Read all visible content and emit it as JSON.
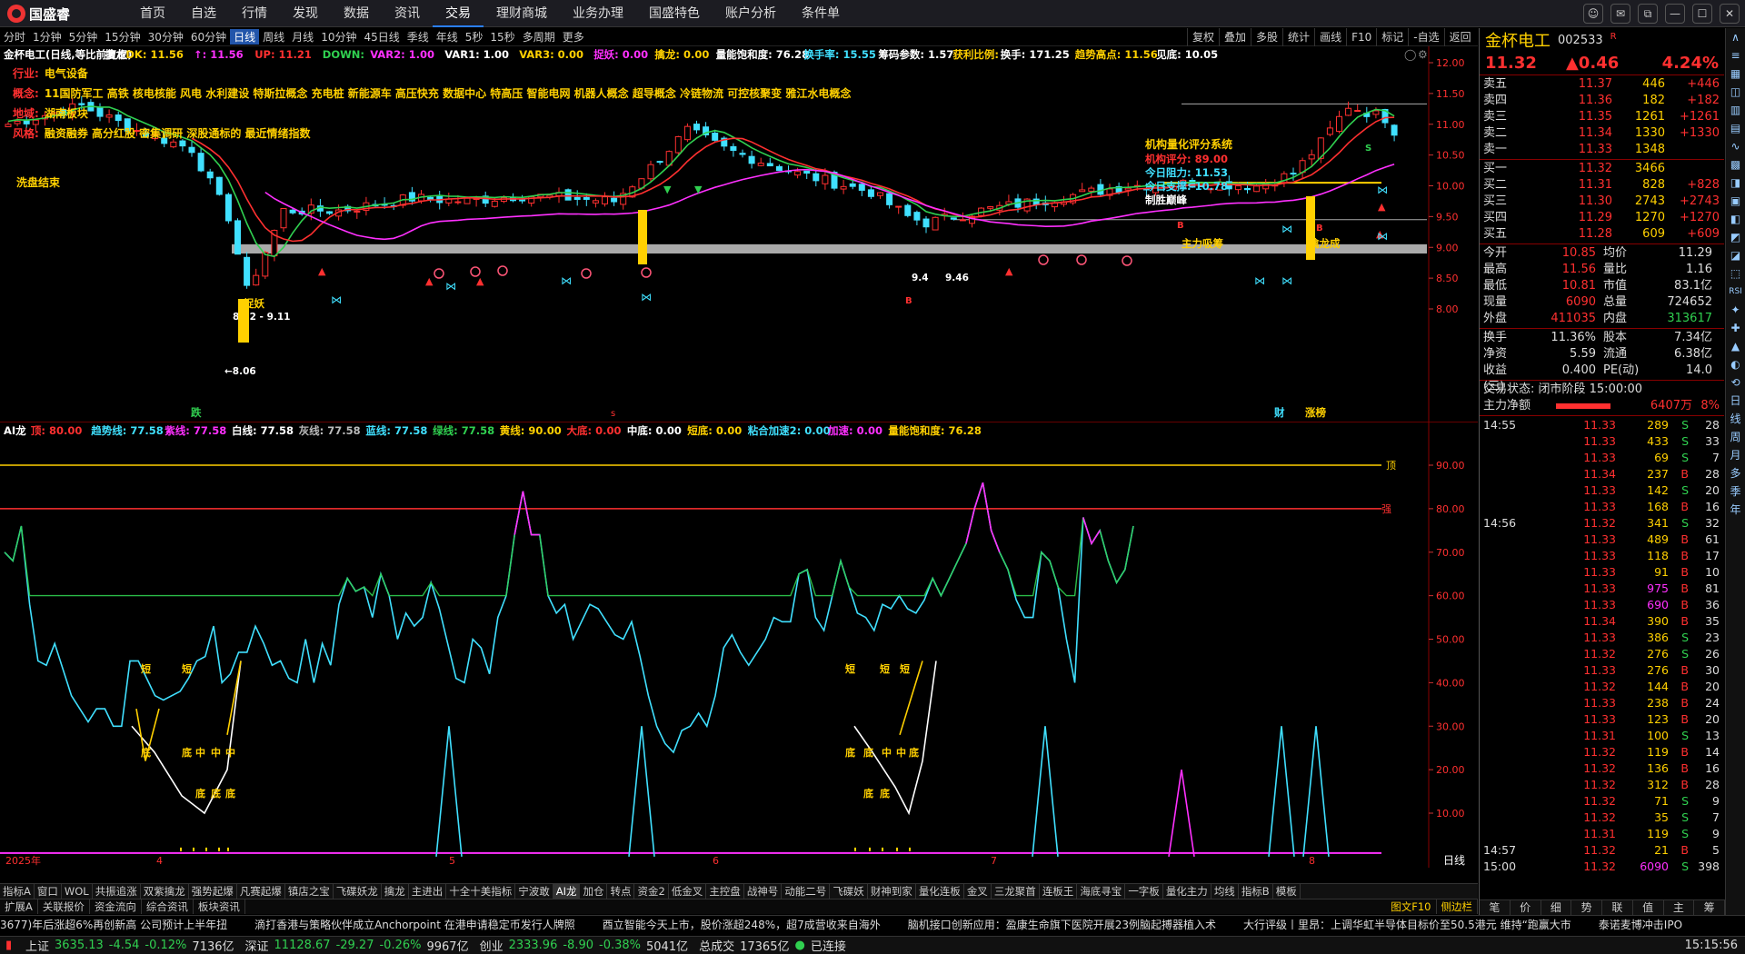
{
  "app": {
    "logo_text": "国盛睿",
    "menu": [
      {
        "label": "首页"
      },
      {
        "label": "自选"
      },
      {
        "label": "行情"
      },
      {
        "label": "发现"
      },
      {
        "label": "数据"
      },
      {
        "label": "资讯"
      },
      {
        "label": "交易",
        "active": true
      },
      {
        "label": "理财商城"
      },
      {
        "label": "业务办理"
      },
      {
        "label": "国盛特色"
      },
      {
        "label": "账户分析"
      },
      {
        "label": "条件单"
      }
    ],
    "window_buttons": [
      "☺",
      "✉",
      "⧉",
      "—",
      "☐",
      "✕"
    ]
  },
  "period_tabs": [
    {
      "label": "分时"
    },
    {
      "label": "1分钟"
    },
    {
      "label": "5分钟"
    },
    {
      "label": "15分钟"
    },
    {
      "label": "30分钟"
    },
    {
      "label": "60分钟"
    },
    {
      "label": "日线",
      "active": true
    },
    {
      "label": "周线"
    },
    {
      "label": "月线"
    },
    {
      "label": "10分钟"
    },
    {
      "label": "45日线"
    },
    {
      "label": "季线"
    },
    {
      "label": "年线"
    },
    {
      "label": "5秒"
    },
    {
      "label": "15秒"
    },
    {
      "label": "多周期"
    },
    {
      "label": "更多"
    }
  ],
  "right_tools": [
    {
      "label": "复权"
    },
    {
      "label": "叠加"
    },
    {
      "label": "多股"
    },
    {
      "label": "统计"
    },
    {
      "label": "画线"
    },
    {
      "label": "F10"
    },
    {
      "label": "标记"
    },
    {
      "label": "-自选"
    },
    {
      "label": "返回"
    }
  ],
  "main": {
    "legend": [
      {
        "t": "金杯电工(日线,等比前复权)",
        "c": "#fff"
      },
      {
        "t": "擒龙",
        "c": "#fff"
      },
      {
        "t": "DK: 11.56",
        "c": "#ffd000"
      },
      {
        "t": "↑: 11.56",
        "c": "#ff30ff"
      },
      {
        "t": "UP: 11.21",
        "c": "#ff3030"
      },
      {
        "t": "DOWN: ",
        "c": "#30d050"
      },
      {
        "t": "VAR2: 1.00",
        "c": "#ff30ff"
      },
      {
        "t": "VAR1: 1.00",
        "c": "#fff"
      },
      {
        "t": "VAR3: 0.00",
        "c": "#ffd000"
      },
      {
        "t": "捉妖: 0.00",
        "c": "#ff30ff"
      },
      {
        "t": "擒龙: 0.00",
        "c": "#ffd000"
      },
      {
        "t": "量能饱和度: 76.28",
        "c": "#fff"
      },
      {
        "t": "换手率: 15.55",
        "c": "#40e0ff"
      },
      {
        "t": "筹码参数: 1.57",
        "c": "#fff"
      },
      {
        "t": "获利比例: ",
        "c": "#ffd000"
      },
      {
        "t": "换手: 171.25",
        "c": "#fff"
      },
      {
        "t": "趋势高点: 11.56",
        "c": "#ffd000"
      },
      {
        "t": "见底: 10.05",
        "c": "#fff"
      }
    ],
    "info_lines": [
      {
        "label": "行业:",
        "text": "电气设备"
      },
      {
        "label": "概念:",
        "text": "11国防军工 高铁 核电核能 风电 水利建设 特斯拉概念 充电桩 新能源车 高压快充 数据中心 特高压 智能电网 机器人概念 超导概念 冷链物流 可控核聚变 雅江水电概念"
      },
      {
        "label": "地域:",
        "text": "湖南板块"
      },
      {
        "label": "风格:",
        "text": "融资融券 高分红股 密集调研 深股通标的 最近情绪指数"
      }
    ],
    "label_xipan": "洗盘结束",
    "y_ticks": [
      "12.00",
      "11.50",
      "11.00",
      "10.50",
      "10.00",
      "9.50",
      "9.00",
      "8.50",
      "8.00"
    ],
    "eval": {
      "title": "机构量化评分系统",
      "lines": [
        {
          "t": "机构评分:",
          "v": "89.00"
        },
        {
          "t": "今日阻力:",
          "v": "11.53"
        },
        {
          "t": "今日支撑:",
          "v": "10.78"
        },
        {
          "t": "制胜巅峰",
          "v": ""
        }
      ]
    },
    "annotations": {
      "zhuoyao": "捉妖",
      "range": "8.92 - 9.11",
      "low": "←8.06",
      "p946a": "9.4",
      "p946b": "9.46",
      "zhuli": "主力吸筹",
      "jianyu": "擒龙成",
      "b1": "B",
      "b2": "B",
      "b3": "B",
      "s1": "S",
      "die": "跌",
      "cai": "财",
      "zhang": "涨榜"
    }
  },
  "sub": {
    "legend": [
      {
        "t": "AI龙",
        "c": "#fff"
      },
      {
        "t": "顶: 80.00",
        "c": "#ff3030"
      },
      {
        "t": "趋势线: 77.58",
        "c": "#40e0ff"
      },
      {
        "t": "紫线: 77.58",
        "c": "#ff30ff"
      },
      {
        "t": "白线: 77.58",
        "c": "#fff"
      },
      {
        "t": "灰线: 77.58",
        "c": "#bbb"
      },
      {
        "t": "蓝线: 77.58",
        "c": "#40e0ff"
      },
      {
        "t": "绿线: 77.58",
        "c": "#30d050"
      },
      {
        "t": "黄线: 90.00",
        "c": "#ffd000"
      },
      {
        "t": "大底: 0.00",
        "c": "#ff3030"
      },
      {
        "t": "中底: 0.00",
        "c": "#fff"
      },
      {
        "t": "短底: 0.00",
        "c": "#ffd000"
      },
      {
        "t": "粘合加速2: 0.00",
        "c": "#40e0ff"
      },
      {
        "t": "加速: 0.00",
        "c": "#ff30ff"
      },
      {
        "t": "量能饱和度: 76.28",
        "c": "#ffd000"
      }
    ],
    "y_ticks": [
      "90.00",
      "80.00",
      "70.00",
      "60.00",
      "50.00",
      "40.00",
      "30.00",
      "20.00",
      "10.00"
    ],
    "labels": {
      "ding": "顶",
      "qiang": "强",
      "duan": "短",
      "di": "底",
      "zhong": "中"
    },
    "x_labels": [
      "2025年",
      "4",
      "5",
      "6",
      "7",
      "8"
    ],
    "x_label_right": "日线"
  },
  "bottom_tabs": [
    {
      "label": "指标A"
    },
    {
      "label": "窗口"
    },
    {
      "label": "WOL"
    },
    {
      "label": "共振追涨"
    },
    {
      "label": "双紫擒龙"
    },
    {
      "label": "强势起爆"
    },
    {
      "label": "凡赛起爆"
    },
    {
      "label": "镇店之宝"
    },
    {
      "label": "飞碟妖龙"
    },
    {
      "label": "擒龙"
    },
    {
      "label": "主进出"
    },
    {
      "label": "十全十美指标"
    },
    {
      "label": "宁波敢"
    },
    {
      "label": "AI龙",
      "active": true
    },
    {
      "label": "加仓"
    },
    {
      "label": "转点"
    },
    {
      "label": "资金2"
    },
    {
      "label": "低金叉"
    },
    {
      "label": "主控盘"
    },
    {
      "label": "战神号"
    },
    {
      "label": "动能二号"
    },
    {
      "label": "飞碟妖"
    },
    {
      "label": "财神到家"
    },
    {
      "label": "量化连板"
    },
    {
      "label": "金叉"
    },
    {
      "label": "三龙聚首"
    },
    {
      "label": "连板王"
    },
    {
      "label": "海底寻宝"
    },
    {
      "label": "一字板"
    },
    {
      "label": "量化主力"
    },
    {
      "label": "均线"
    },
    {
      "label": "指标B"
    },
    {
      "label": "模板"
    }
  ],
  "bottom_tabs2": [
    {
      "label": "扩展A"
    },
    {
      "label": "关联报价"
    },
    {
      "label": "资金流向"
    },
    {
      "label": "综合资讯"
    },
    {
      "label": "板块资讯"
    }
  ],
  "right_bottom_tabs": [
    {
      "label": "图文F10"
    },
    {
      "label": "侧边栏"
    }
  ],
  "ticker": [
    "3677)年后涨超6%再创新高 公司预计上半年扭",
    "滴打香港与策略伙伴成立Anchorpoint 在港申请稳定币发行人牌照",
    "酉立智能今天上市，股价涨超248%，超7成营收来自海外",
    "脑机接口创新应用：盈康生命旗下医院开展23例脑起搏器植入术",
    "大行评级丨里昂：上调华虹半导体目标价至50.5港元 维持“跑赢大市",
    "泰诺麦博冲击IPO"
  ],
  "status": {
    "sh_label": "上证",
    "sh": "3635.13",
    "sh_chg": "-4.54",
    "sh_pct": "-0.12%",
    "sh_amt": "7136亿",
    "sz_label": "深证",
    "sz": "11128.67",
    "sz_chg": "-29.27",
    "sz_pct": "-0.26%",
    "sz_amt": "9967亿",
    "cy_label": "创业",
    "cy": "2333.96",
    "cy_chg": "-8.90",
    "cy_pct": "-0.38%",
    "cy_amt": "5041亿",
    "total_label": "总成交",
    "total": "17365亿",
    "conn": "已连接",
    "time": "15:15:56"
  },
  "right": {
    "name": "金杯电工",
    "code": "002533",
    "flag": "R",
    "price": "11.32",
    "chg": "▲0.46",
    "pct": "4.24%",
    "asks": [
      {
        "l": "卖五",
        "p": "11.37",
        "v": "446",
        "d": "+446"
      },
      {
        "l": "卖四",
        "p": "11.36",
        "v": "182",
        "d": "+182"
      },
      {
        "l": "卖三",
        "p": "11.35",
        "v": "1261",
        "d": "+1261"
      },
      {
        "l": "卖二",
        "p": "11.34",
        "v": "1330",
        "d": "+1330"
      },
      {
        "l": "卖一",
        "p": "11.33",
        "v": "1348",
        "d": ""
      }
    ],
    "bids": [
      {
        "l": "买一",
        "p": "11.32",
        "v": "3466",
        "d": ""
      },
      {
        "l": "买二",
        "p": "11.31",
        "v": "828",
        "d": "+828"
      },
      {
        "l": "买三",
        "p": "11.30",
        "v": "2743",
        "d": "+2743"
      },
      {
        "l": "买四",
        "p": "11.29",
        "v": "1270",
        "d": "+1270"
      },
      {
        "l": "买五",
        "p": "11.28",
        "v": "609",
        "d": "+609"
      }
    ],
    "quote": [
      {
        "a": "今开",
        "av": "10.85",
        "b": "均价",
        "bv": "11.29"
      },
      {
        "a": "最高",
        "av": "11.56",
        "b": "量比",
        "bv": "1.16"
      },
      {
        "a": "最低",
        "av": "10.81",
        "b": "市值",
        "bv": "83.1亿"
      },
      {
        "a": "现量",
        "av": "6090",
        "b": "总量",
        "bv": "724652"
      },
      {
        "a": "外盘",
        "av": "411035",
        "b": "内盘",
        "bv": "313617"
      }
    ],
    "quote2": [
      {
        "a": "换手",
        "av": "11.36%",
        "b": "股本",
        "bv": "7.34亿"
      },
      {
        "a": "净资",
        "av": "5.59",
        "b": "流通",
        "bv": "6.38亿"
      },
      {
        "a": "收益(三)",
        "av": "0.400",
        "b": "PE(动)",
        "bv": "14.0"
      }
    ],
    "trade_status": "交易状态: 闭市阶段 15:00:00",
    "net_label": "主力净额",
    "net_val": "6407万",
    "net_pct": "8%",
    "ticks": [
      {
        "t": "14:55",
        "p": "11.33",
        "v": "289",
        "bs": "S",
        "n": "28"
      },
      {
        "t": "",
        "p": "11.33",
        "v": "433",
        "bs": "S",
        "n": "33"
      },
      {
        "t": "",
        "p": "11.33",
        "v": "69",
        "bs": "S",
        "n": "7"
      },
      {
        "t": "",
        "p": "11.34",
        "v": "237",
        "bs": "B",
        "n": "28"
      },
      {
        "t": "",
        "p": "11.33",
        "v": "142",
        "bs": "S",
        "n": "20"
      },
      {
        "t": "",
        "p": "11.33",
        "v": "168",
        "bs": "B",
        "n": "16"
      },
      {
        "t": "14:56",
        "p": "11.32",
        "v": "341",
        "bs": "S",
        "n": "32"
      },
      {
        "t": "",
        "p": "11.33",
        "v": "489",
        "bs": "B",
        "n": "61"
      },
      {
        "t": "",
        "p": "11.33",
        "v": "118",
        "bs": "B",
        "n": "17"
      },
      {
        "t": "",
        "p": "11.33",
        "v": "91",
        "bs": "B",
        "n": "10"
      },
      {
        "t": "",
        "p": "11.33",
        "v": "975",
        "bs": "B",
        "n": "81"
      },
      {
        "t": "",
        "p": "11.33",
        "v": "690",
        "bs": "B",
        "n": "36"
      },
      {
        "t": "",
        "p": "11.34",
        "v": "390",
        "bs": "B",
        "n": "35"
      },
      {
        "t": "",
        "p": "11.33",
        "v": "386",
        "bs": "S",
        "n": "23"
      },
      {
        "t": "",
        "p": "11.32",
        "v": "276",
        "bs": "S",
        "n": "26"
      },
      {
        "t": "",
        "p": "11.33",
        "v": "276",
        "bs": "B",
        "n": "30"
      },
      {
        "t": "",
        "p": "11.32",
        "v": "144",
        "bs": "B",
        "n": "20"
      },
      {
        "t": "",
        "p": "11.33",
        "v": "238",
        "bs": "B",
        "n": "24"
      },
      {
        "t": "",
        "p": "11.33",
        "v": "123",
        "bs": "B",
        "n": "20"
      },
      {
        "t": "",
        "p": "11.31",
        "v": "100",
        "bs": "S",
        "n": "13"
      },
      {
        "t": "",
        "p": "11.32",
        "v": "119",
        "bs": "B",
        "n": "14"
      },
      {
        "t": "",
        "p": "11.32",
        "v": "136",
        "bs": "B",
        "n": "16"
      },
      {
        "t": "",
        "p": "11.32",
        "v": "312",
        "bs": "B",
        "n": "28"
      },
      {
        "t": "",
        "p": "11.32",
        "v": "71",
        "bs": "S",
        "n": "9"
      },
      {
        "t": "",
        "p": "11.32",
        "v": "35",
        "bs": "S",
        "n": "7"
      },
      {
        "t": "",
        "p": "11.31",
        "v": "119",
        "bs": "S",
        "n": "9"
      },
      {
        "t": "14:57",
        "p": "11.32",
        "v": "21",
        "bs": "B",
        "n": "5"
      },
      {
        "t": "15:00",
        "p": "11.32",
        "v": "6090",
        "bs": "S",
        "n": "398"
      }
    ],
    "bottom_tabs": [
      {
        "label": "笔"
      },
      {
        "label": "价"
      },
      {
        "label": "细"
      },
      {
        "label": "势"
      },
      {
        "label": "联"
      },
      {
        "label": "值"
      },
      {
        "label": "主"
      },
      {
        "label": "筹"
      }
    ]
  },
  "side_icons": [
    "∧",
    "≡",
    "▦",
    "◫",
    "▥",
    "▤",
    "∿",
    "▩",
    "◨",
    "▣",
    "◧",
    "◩",
    "◪",
    "⬚",
    "RSI",
    "✦",
    "✚",
    "▲",
    "◐",
    "⟲"
  ],
  "side_labels": [
    "日",
    "线",
    "周",
    "月",
    "多",
    "季",
    "年"
  ],
  "colors": {
    "up": "#ff3030",
    "down": "#30d050",
    "yellow": "#ffd000",
    "cyan": "#40e0ff",
    "magenta": "#ff30ff",
    "white": "#ffffff"
  }
}
